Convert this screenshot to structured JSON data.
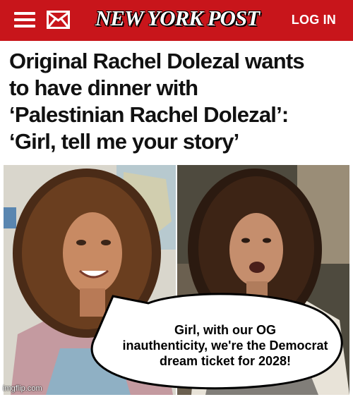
{
  "header": {
    "brand": "NEW YORK POST",
    "login_label": "LOG IN",
    "bar_color": "#c8151b",
    "icons": [
      "menu-icon",
      "mail-icon"
    ]
  },
  "article": {
    "headline_lines": [
      "Original Rachel Dolezal wants",
      "to have dinner with",
      "‘Palestinian Rachel Dolezal’:",
      "‘Girl, tell me your story’"
    ]
  },
  "meme": {
    "caption_lines": [
      "Girl, with our OG",
      "inauthenticity, we're the Democrat",
      "dream ticket for 2028!"
    ]
  },
  "watermark": "imgflip.com"
}
